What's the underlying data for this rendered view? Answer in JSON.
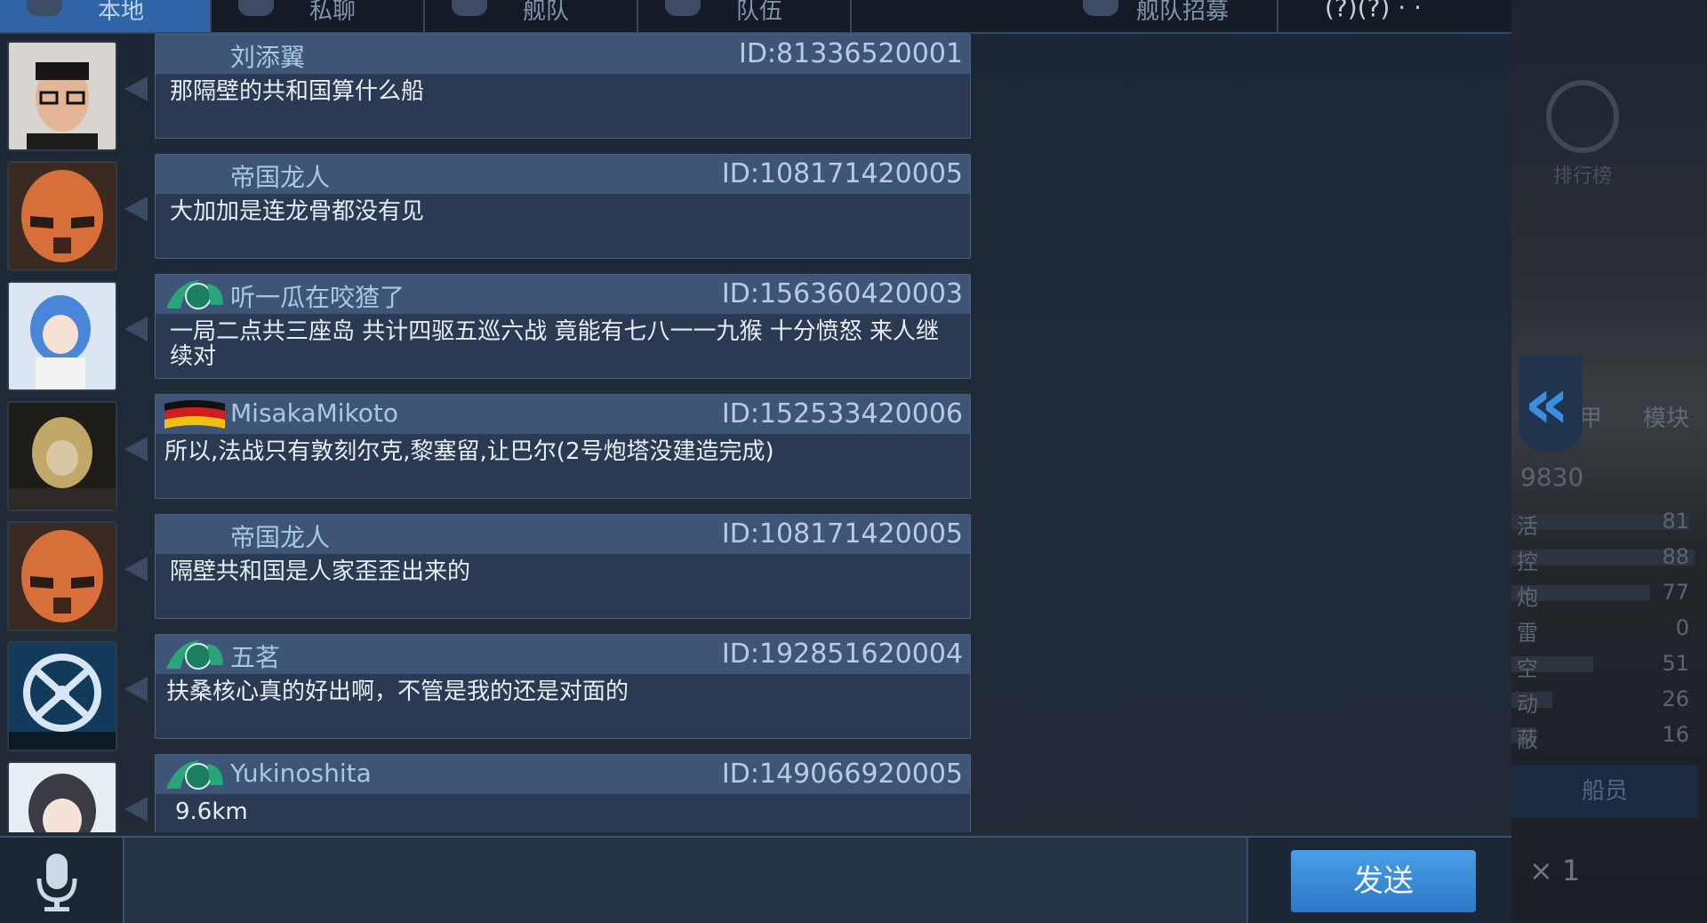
{
  "tabs": [
    {
      "label": "本地",
      "active": true
    },
    {
      "label": "私聊",
      "active": false
    },
    {
      "label": "舰队",
      "active": false
    },
    {
      "label": "队伍",
      "active": false
    },
    {
      "label": "舰队招募",
      "active": false
    }
  ],
  "status_bar": {
    "text": "(?)(?) ·  ·"
  },
  "messages": [
    {
      "name": "刘添翼",
      "id": "ID:81336520001",
      "text": "那隔壁的共和国算什么船",
      "badge": "",
      "avatar": "face-avatar"
    },
    {
      "name": "帝国龙人",
      "id": "ID:108171420005",
      "text": "大加加是连龙骨都没有见",
      "badge": "",
      "avatar": "trooper-helmet-avatar"
    },
    {
      "name": "听一瓜在咬猹了",
      "id": "ID:156360420003",
      "text": "一局二点共三座岛  共计四驱五巡六战  竟能有七八一一九猴  十分愤怒    来人继续对",
      "badge": "green-wing-badge",
      "avatar": "anime-girl-avatar"
    },
    {
      "name": "MisakaMikoto",
      "id": "ID:152533420006",
      "text": "所以,法战只有敦刻尔克,黎塞留,让巴尔(2号炮塔没建造完成)",
      "badge": "german-flag-badge",
      "avatar": "bismarck-avatar"
    },
    {
      "name": "帝国龙人",
      "id": "ID:108171420005",
      "text": "隔壁共和国是人家歪歪出来的",
      "badge": "",
      "avatar": "trooper-helmet-avatar"
    },
    {
      "name": "五茗",
      "id": "ID:192851620004",
      "text": "扶桑核心真的好出啊，不管是我的还是对面的",
      "badge": "green-wing-badge",
      "avatar": "emblem-avatar"
    },
    {
      "name": "Yukinoshita",
      "id": "ID:149066920005",
      "text": "9.6km",
      "badge": "green-wing-badge",
      "avatar": "anime-girl-avatar-2"
    }
  ],
  "input": {
    "placeholder": "",
    "send_label": "发送"
  },
  "right_panel": {
    "rank_label": "排行榜",
    "score": "9830",
    "armor_label": "装甲",
    "module_label": "模块",
    "stats": [
      {
        "label": "活",
        "value": "81"
      },
      {
        "label": "控",
        "value": "88"
      },
      {
        "label": "炮",
        "value": "77"
      },
      {
        "label": "雷",
        "value": "0"
      },
      {
        "label": "空",
        "value": "51"
      },
      {
        "label": "动",
        "value": "26"
      },
      {
        "label": "蔽",
        "value": "16"
      }
    ],
    "crew_label": "船员",
    "multiplier": "× 1"
  },
  "colors": {
    "accent": "#2f64a6",
    "send": "#3a8ddb",
    "bubble": "#2a3a52"
  }
}
